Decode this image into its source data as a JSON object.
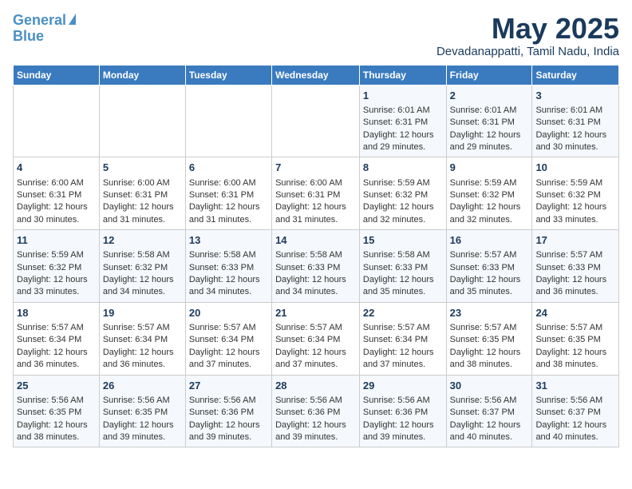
{
  "header": {
    "logo_line1": "General",
    "logo_line2": "Blue",
    "month_title": "May 2025",
    "location": "Devadanappatti, Tamil Nadu, India"
  },
  "columns": [
    "Sunday",
    "Monday",
    "Tuesday",
    "Wednesday",
    "Thursday",
    "Friday",
    "Saturday"
  ],
  "weeks": [
    [
      {
        "day": "",
        "info": ""
      },
      {
        "day": "",
        "info": ""
      },
      {
        "day": "",
        "info": ""
      },
      {
        "day": "",
        "info": ""
      },
      {
        "day": "1",
        "info": "Sunrise: 6:01 AM\nSunset: 6:31 PM\nDaylight: 12 hours and 29 minutes."
      },
      {
        "day": "2",
        "info": "Sunrise: 6:01 AM\nSunset: 6:31 PM\nDaylight: 12 hours and 29 minutes."
      },
      {
        "day": "3",
        "info": "Sunrise: 6:01 AM\nSunset: 6:31 PM\nDaylight: 12 hours and 30 minutes."
      }
    ],
    [
      {
        "day": "4",
        "info": "Sunrise: 6:00 AM\nSunset: 6:31 PM\nDaylight: 12 hours and 30 minutes."
      },
      {
        "day": "5",
        "info": "Sunrise: 6:00 AM\nSunset: 6:31 PM\nDaylight: 12 hours and 31 minutes."
      },
      {
        "day": "6",
        "info": "Sunrise: 6:00 AM\nSunset: 6:31 PM\nDaylight: 12 hours and 31 minutes."
      },
      {
        "day": "7",
        "info": "Sunrise: 6:00 AM\nSunset: 6:31 PM\nDaylight: 12 hours and 31 minutes."
      },
      {
        "day": "8",
        "info": "Sunrise: 5:59 AM\nSunset: 6:32 PM\nDaylight: 12 hours and 32 minutes."
      },
      {
        "day": "9",
        "info": "Sunrise: 5:59 AM\nSunset: 6:32 PM\nDaylight: 12 hours and 32 minutes."
      },
      {
        "day": "10",
        "info": "Sunrise: 5:59 AM\nSunset: 6:32 PM\nDaylight: 12 hours and 33 minutes."
      }
    ],
    [
      {
        "day": "11",
        "info": "Sunrise: 5:59 AM\nSunset: 6:32 PM\nDaylight: 12 hours and 33 minutes."
      },
      {
        "day": "12",
        "info": "Sunrise: 5:58 AM\nSunset: 6:32 PM\nDaylight: 12 hours and 34 minutes."
      },
      {
        "day": "13",
        "info": "Sunrise: 5:58 AM\nSunset: 6:33 PM\nDaylight: 12 hours and 34 minutes."
      },
      {
        "day": "14",
        "info": "Sunrise: 5:58 AM\nSunset: 6:33 PM\nDaylight: 12 hours and 34 minutes."
      },
      {
        "day": "15",
        "info": "Sunrise: 5:58 AM\nSunset: 6:33 PM\nDaylight: 12 hours and 35 minutes."
      },
      {
        "day": "16",
        "info": "Sunrise: 5:57 AM\nSunset: 6:33 PM\nDaylight: 12 hours and 35 minutes."
      },
      {
        "day": "17",
        "info": "Sunrise: 5:57 AM\nSunset: 6:33 PM\nDaylight: 12 hours and 36 minutes."
      }
    ],
    [
      {
        "day": "18",
        "info": "Sunrise: 5:57 AM\nSunset: 6:34 PM\nDaylight: 12 hours and 36 minutes."
      },
      {
        "day": "19",
        "info": "Sunrise: 5:57 AM\nSunset: 6:34 PM\nDaylight: 12 hours and 36 minutes."
      },
      {
        "day": "20",
        "info": "Sunrise: 5:57 AM\nSunset: 6:34 PM\nDaylight: 12 hours and 37 minutes."
      },
      {
        "day": "21",
        "info": "Sunrise: 5:57 AM\nSunset: 6:34 PM\nDaylight: 12 hours and 37 minutes."
      },
      {
        "day": "22",
        "info": "Sunrise: 5:57 AM\nSunset: 6:34 PM\nDaylight: 12 hours and 37 minutes."
      },
      {
        "day": "23",
        "info": "Sunrise: 5:57 AM\nSunset: 6:35 PM\nDaylight: 12 hours and 38 minutes."
      },
      {
        "day": "24",
        "info": "Sunrise: 5:57 AM\nSunset: 6:35 PM\nDaylight: 12 hours and 38 minutes."
      }
    ],
    [
      {
        "day": "25",
        "info": "Sunrise: 5:56 AM\nSunset: 6:35 PM\nDaylight: 12 hours and 38 minutes."
      },
      {
        "day": "26",
        "info": "Sunrise: 5:56 AM\nSunset: 6:35 PM\nDaylight: 12 hours and 39 minutes."
      },
      {
        "day": "27",
        "info": "Sunrise: 5:56 AM\nSunset: 6:36 PM\nDaylight: 12 hours and 39 minutes."
      },
      {
        "day": "28",
        "info": "Sunrise: 5:56 AM\nSunset: 6:36 PM\nDaylight: 12 hours and 39 minutes."
      },
      {
        "day": "29",
        "info": "Sunrise: 5:56 AM\nSunset: 6:36 PM\nDaylight: 12 hours and 39 minutes."
      },
      {
        "day": "30",
        "info": "Sunrise: 5:56 AM\nSunset: 6:37 PM\nDaylight: 12 hours and 40 minutes."
      },
      {
        "day": "31",
        "info": "Sunrise: 5:56 AM\nSunset: 6:37 PM\nDaylight: 12 hours and 40 minutes."
      }
    ]
  ]
}
